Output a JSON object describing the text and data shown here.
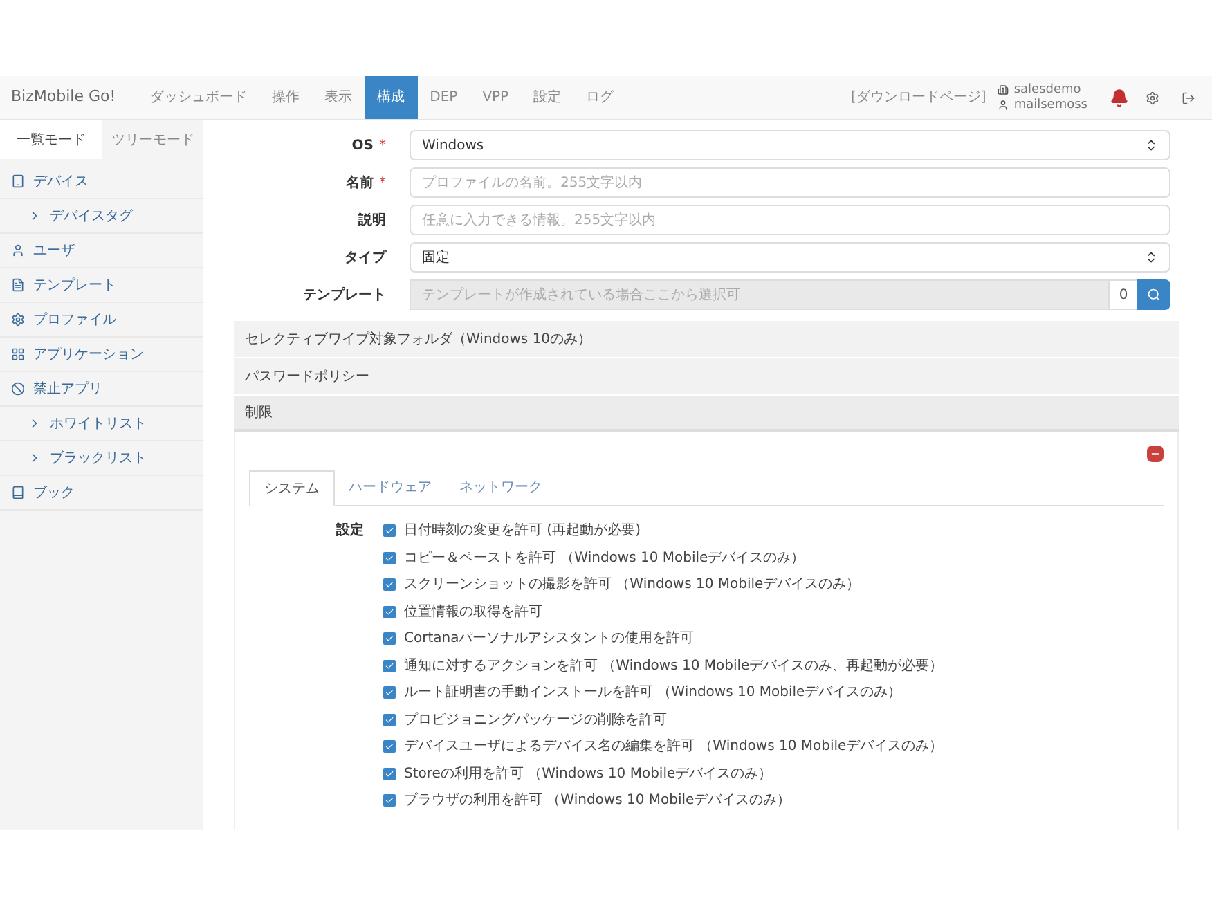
{
  "header": {
    "logo": "BizMobile Go!",
    "nav": [
      {
        "label": "ダッシュボード",
        "selected": false
      },
      {
        "label": "操作",
        "selected": false
      },
      {
        "label": "表示",
        "selected": false
      },
      {
        "label": "構成",
        "selected": true
      },
      {
        "label": "DEP",
        "selected": false
      },
      {
        "label": "VPP",
        "selected": false
      },
      {
        "label": "設定",
        "selected": false
      },
      {
        "label": "ログ",
        "selected": false
      }
    ],
    "download_link": "[ダウンロードページ]",
    "company": "salesdemo",
    "user": "mailsemoss"
  },
  "sidebar": {
    "modes": [
      {
        "label": "一覧モード",
        "selected": true
      },
      {
        "label": "ツリーモード",
        "selected": false
      }
    ],
    "items": [
      {
        "label": "デバイス",
        "children": [
          {
            "label": "デバイスタグ"
          }
        ]
      },
      {
        "label": "ユーザ"
      },
      {
        "label": "テンプレート"
      },
      {
        "label": "プロファイル"
      },
      {
        "label": "アプリケーション"
      },
      {
        "label": "禁止アプリ",
        "children": [
          {
            "label": "ホワイトリスト"
          },
          {
            "label": "ブラックリスト"
          }
        ]
      },
      {
        "label": "ブック"
      }
    ]
  },
  "form": {
    "fields": [
      {
        "kind": "select",
        "label": "OS",
        "required_mark": "*",
        "value": "Windows"
      },
      {
        "kind": "text",
        "label": "名前",
        "required_mark": "*",
        "placeholder": "プロファイルの名前。255文字以内"
      },
      {
        "kind": "text",
        "label": "説明",
        "placeholder": "任意に入力できる情報。255文字以内"
      },
      {
        "kind": "select",
        "label": "タイプ",
        "value": "固定"
      },
      {
        "kind": "search",
        "label": "テンプレート",
        "placeholder": "テンプレートが作成されている場合ここから選択可",
        "count": "0"
      }
    ]
  },
  "sections": [
    {
      "title": "セレクティブワイプ対象フォルダ（Windows 10のみ）",
      "expanded": false
    },
    {
      "title": "パスワードポリシー",
      "expanded": false
    },
    {
      "title": "制限",
      "expanded": true
    }
  ],
  "restrictions": {
    "tabs": [
      {
        "label": "システム",
        "selected": true
      },
      {
        "label": "ハードウェア",
        "selected": false
      },
      {
        "label": "ネットワーク",
        "selected": false
      }
    ],
    "settings_label": "設定",
    "options": [
      {
        "label": "日付時刻の変更を許可 (再起動が必要)",
        "checked": true
      },
      {
        "label": "コピー＆ペーストを許可 （Windows 10 Mobileデバイスのみ）",
        "checked": true
      },
      {
        "label": "スクリーンショットの撮影を許可 （Windows 10 Mobileデバイスのみ）",
        "checked": true
      },
      {
        "label": "位置情報の取得を許可",
        "checked": true
      },
      {
        "label": "Cortanaパーソナルアシスタントの使用を許可",
        "checked": true
      },
      {
        "label": "通知に対するアクションを許可 （Windows 10 Mobileデバイスのみ、再起動が必要）",
        "checked": true
      },
      {
        "label": "ルート証明書の手動インストールを許可 （Windows 10 Mobileデバイスのみ）",
        "checked": true
      },
      {
        "label": "プロビジョニングパッケージの削除を許可",
        "checked": true
      },
      {
        "label": "デバイスユーザによるデバイス名の編集を許可 （Windows 10 Mobileデバイスのみ）",
        "checked": true
      },
      {
        "label": "Storeの利用を許可 （Windows 10 Mobileデバイスのみ）",
        "checked": true
      },
      {
        "label": "ブラウザの利用を許可 （Windows 10 Mobileデバイスのみ）",
        "checked": true
      }
    ]
  }
}
